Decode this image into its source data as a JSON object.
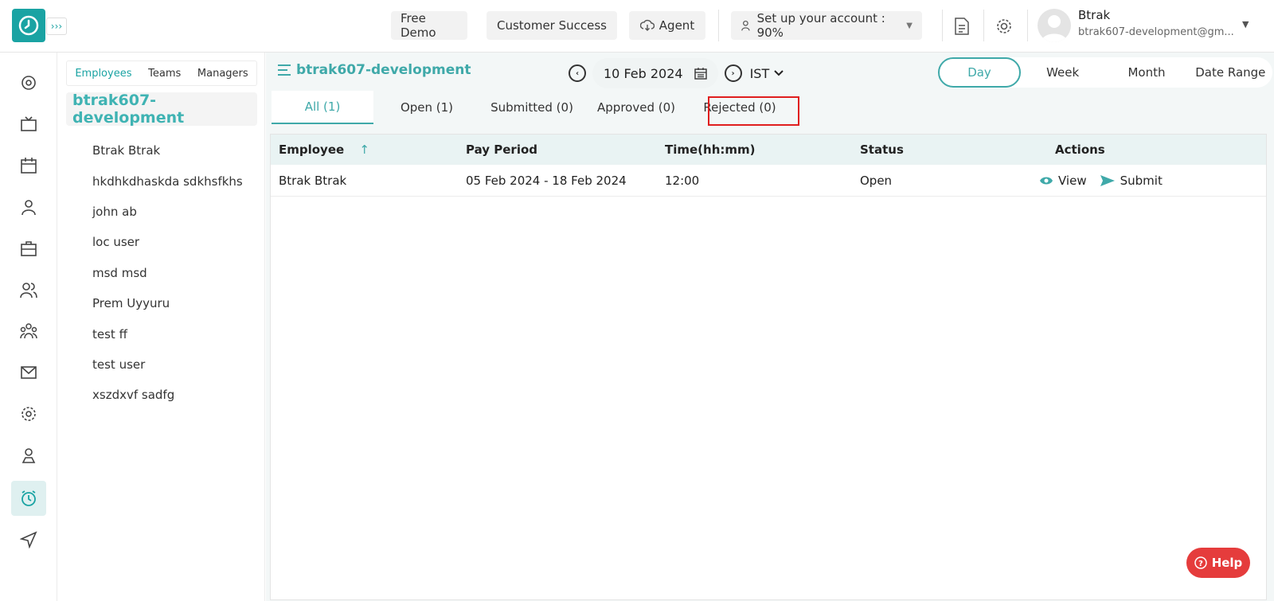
{
  "header": {
    "free_demo": "Free Demo",
    "customer_success": "Customer Success",
    "agent": "Agent",
    "setup": "Set up your account : 90%",
    "user_name": "Btrak",
    "user_email": "btrak607-development@gm..."
  },
  "employees_panel": {
    "tabs": [
      "Employees",
      "Teams",
      "Managers"
    ],
    "org": "btrak607-development",
    "employees": [
      "Btrak Btrak",
      "hkdhkdhaskda sdkhsfkhs",
      "john ab",
      "loc user",
      "msd msd",
      "Prem Uyyuru",
      "test ff",
      "test user",
      "xszdxvf sadfg"
    ]
  },
  "main": {
    "title": "btrak607-development",
    "date": "10 Feb 2024",
    "timezone": "IST",
    "ranges": [
      "Day",
      "Week",
      "Month",
      "Date Range"
    ],
    "status_tabs": [
      "All (1)",
      "Open (1)",
      "Submitted (0)",
      "Approved (0)",
      "Rejected (0)"
    ]
  },
  "table": {
    "headers": [
      "Employee",
      "Pay Period",
      "Time(hh:mm)",
      "Status",
      "Actions"
    ],
    "rows": [
      {
        "employee": "Btrak Btrak",
        "pay_period": "05 Feb 2024 - 18 Feb 2024",
        "time": "12:00",
        "status": "Open",
        "view": "View",
        "submit": "Submit"
      }
    ]
  },
  "help": "Help",
  "colors": {
    "accent": "#1aa3a3",
    "highlight": "#e01e1e",
    "help": "#e53c3c"
  }
}
